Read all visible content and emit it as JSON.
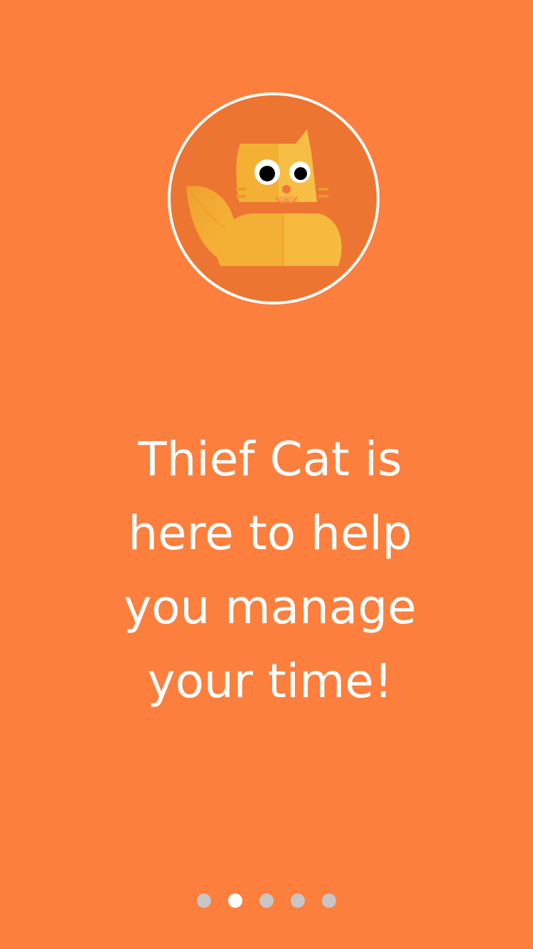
{
  "app": {
    "logo_icon": "thief-cat-icon"
  },
  "onboarding": {
    "message_lines": [
      "Thief Cat is",
      "here to help",
      "you manage",
      "your time!"
    ]
  },
  "pager": {
    "page_count": 5,
    "active_page": 2
  },
  "colors": {
    "background": "#fc7f3d",
    "logo_background": "#ed7532",
    "cat_body": "#f4b035",
    "text": "#ffffff",
    "dot_active": "#ffffff",
    "dot_inactive": "#c8c5c4"
  }
}
